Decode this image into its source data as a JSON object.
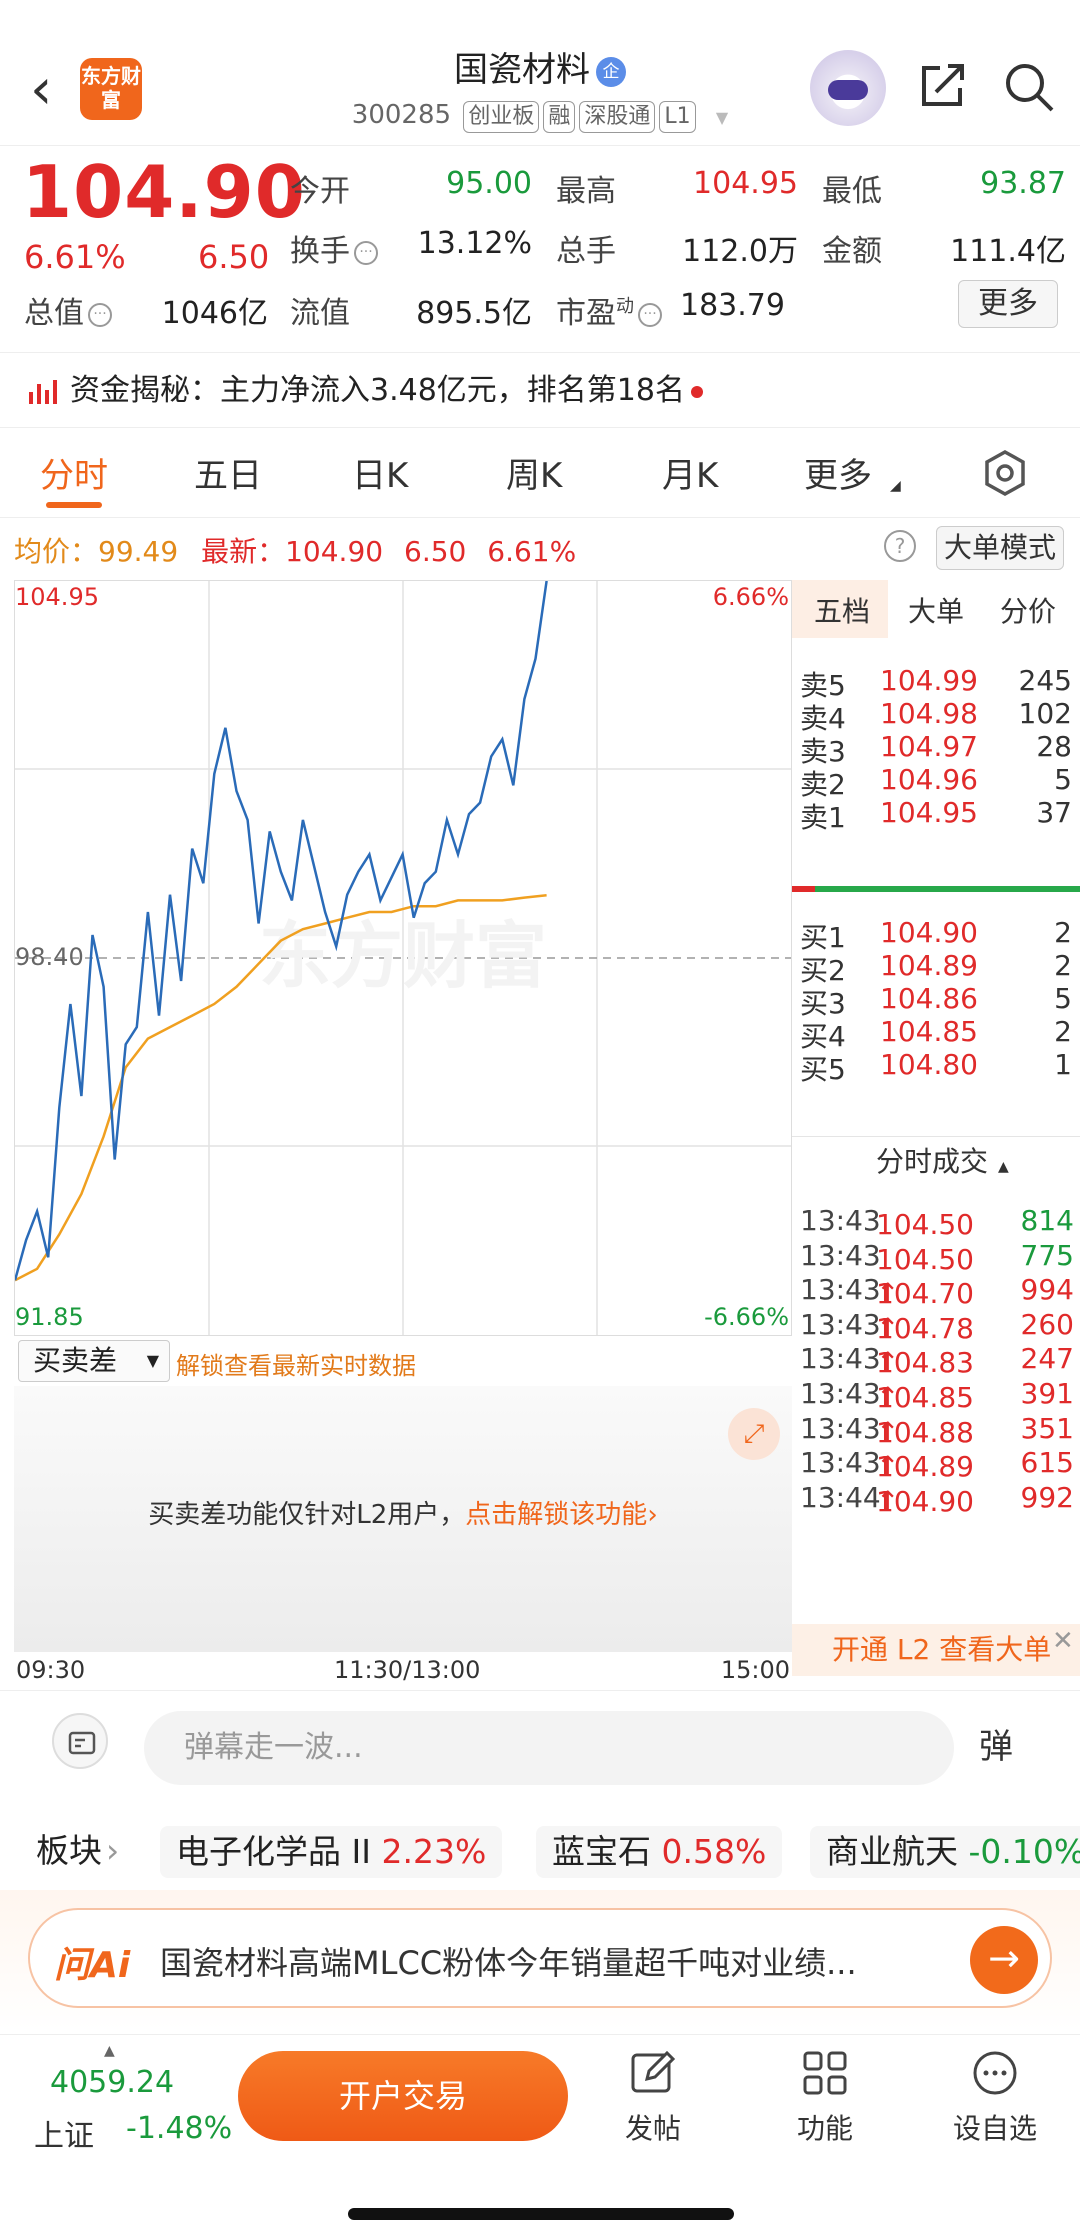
{
  "header": {
    "logo_text": "东方财富",
    "title": "国瓷材料",
    "title_badge": "企",
    "code": "300285",
    "tags": [
      "创业板",
      "融",
      "深股通",
      "L1"
    ]
  },
  "quote": {
    "price": "104.90",
    "change_pct": "6.61%",
    "change": "6.50",
    "fields": [
      {
        "label": "今开",
        "value": "95.00",
        "color": "green"
      },
      {
        "label": "最高",
        "value": "104.95",
        "color": "red"
      },
      {
        "label": "最低",
        "value": "93.87",
        "color": "green"
      },
      {
        "label": "换手",
        "value": "13.12%",
        "color": "black"
      },
      {
        "label": "总手",
        "value": "112.0万",
        "color": "black"
      },
      {
        "label": "金额",
        "value": "111.4亿",
        "color": "black"
      },
      {
        "label": "总值",
        "value": "1046亿",
        "color": "black"
      },
      {
        "label": "流值",
        "value": "895.5亿",
        "color": "black"
      },
      {
        "label": "市盈",
        "label_sup": "动",
        "value": "183.79",
        "color": "black"
      }
    ],
    "more_button": "更多"
  },
  "capital_flow": {
    "text": "资金揭秘：主力净流入3.48亿元，排名第18名"
  },
  "tabs": {
    "items": [
      "分时",
      "五日",
      "日K",
      "周K",
      "月K",
      "更多"
    ],
    "active": "分时"
  },
  "avg_row": {
    "avg_label": "均价：",
    "avg_value": "99.49",
    "latest_label": "最新：",
    "latest_value": "104.90",
    "latest_change": "6.50",
    "latest_pct": "6.61%",
    "help": "?",
    "big_mode": "大单模式"
  },
  "chart_data": {
    "type": "line",
    "y_top": "104.95",
    "y_mid": "98.40",
    "y_bottom": "91.85",
    "pct_top": "6.66%",
    "pct_bottom": "-6.66%",
    "ylim": [
      91.85,
      104.95
    ],
    "watermark": "东方财富",
    "series": [
      {
        "values": [
          92.8,
          93.5,
          94.0,
          93.2,
          95.8,
          97.6,
          96.0,
          98.8,
          97.9,
          94.9,
          96.9,
          97.2,
          99.2,
          97.4,
          99.5,
          98.0,
          100.3,
          99.7,
          101.6,
          102.4,
          101.3,
          100.8,
          99.0,
          100.6,
          99.9,
          99.4,
          100.8,
          100.0,
          99.2,
          98.6,
          99.5,
          99.9,
          100.2,
          99.4,
          99.8,
          100.2,
          99.1,
          99.7,
          99.9,
          100.8,
          100.2,
          100.9,
          101.1,
          101.9,
          102.2,
          101.4,
          102.9,
          103.6,
          104.95
        ]
      },
      {
        "values": [
          92.8,
          93.0,
          93.6,
          94.3,
          95.3,
          96.5,
          97.0,
          97.2,
          97.4,
          97.6,
          97.9,
          98.3,
          98.7,
          98.9,
          99.0,
          99.1,
          99.2,
          99.2,
          99.3,
          99.3,
          99.4,
          99.4,
          99.4,
          99.45,
          99.49
        ]
      }
    ]
  },
  "order_book": {
    "tabs": [
      "五档",
      "大单",
      "分价"
    ],
    "active_tab": "五档",
    "sells": [
      {
        "label": "卖5",
        "price": "104.99",
        "vol": "245"
      },
      {
        "label": "卖4",
        "price": "104.98",
        "vol": "102"
      },
      {
        "label": "卖3",
        "price": "104.97",
        "vol": "28"
      },
      {
        "label": "卖2",
        "price": "104.96",
        "vol": "5"
      },
      {
        "label": "卖1",
        "price": "104.95",
        "vol": "37"
      }
    ],
    "buys": [
      {
        "label": "买1",
        "price": "104.90",
        "vol": "2"
      },
      {
        "label": "买2",
        "price": "104.89",
        "vol": "2"
      },
      {
        "label": "买3",
        "price": "104.86",
        "vol": "5"
      },
      {
        "label": "买4",
        "price": "104.85",
        "vol": "2"
      },
      {
        "label": "买5",
        "price": "104.80",
        "vol": "1"
      }
    ],
    "trades_title": "分时成交",
    "trades": [
      {
        "time": "13:43",
        "price": "104.50",
        "arrow": "",
        "vol": "814",
        "color": "green"
      },
      {
        "time": "13:43",
        "price": "104.50",
        "arrow": "",
        "vol": "775",
        "color": "green"
      },
      {
        "time": "13:43",
        "price": "104.70",
        "arrow": "↑",
        "vol": "994",
        "color": "red"
      },
      {
        "time": "13:43",
        "price": "104.78",
        "arrow": "↑",
        "vol": "260",
        "color": "red"
      },
      {
        "time": "13:43",
        "price": "104.83",
        "arrow": "↑",
        "vol": "247",
        "color": "red"
      },
      {
        "time": "13:43",
        "price": "104.85",
        "arrow": "↑",
        "vol": "391",
        "color": "red"
      },
      {
        "time": "13:43",
        "price": "104.88",
        "arrow": "↑",
        "vol": "351",
        "color": "red"
      },
      {
        "time": "13:43",
        "price": "104.89",
        "arrow": "↑",
        "vol": "615",
        "color": "red"
      },
      {
        "time": "13:44",
        "price": "104.90",
        "arrow": "↑",
        "vol": "992",
        "color": "red"
      }
    ],
    "l2_promo": "开通 L2 查看大单"
  },
  "buy_sell_diff": {
    "select_label": "买卖差",
    "unlock_link": "解锁查看最新实时数据",
    "message": "买卖差功能仅针对L2用户，",
    "message_link": "点击解锁该功能"
  },
  "time_axis": [
    "09:30",
    "11:30/13:00",
    "15:00"
  ],
  "danmu": {
    "placeholder": "弹幕走一波...",
    "button": "弹"
  },
  "sectors": {
    "label": "板块",
    "items": [
      {
        "name": "电子化学品 II",
        "pct": "2.23%",
        "color": "red"
      },
      {
        "name": "蓝宝石",
        "pct": "0.58%",
        "color": "red"
      },
      {
        "name": "商业航天",
        "pct": "-0.10%",
        "color": "green"
      }
    ]
  },
  "ai": {
    "logo": "问Ai",
    "text": "国瓷材料高端MLCC粉体今年销量超千吨对业绩..."
  },
  "bottom_nav": {
    "index_value": "4059.24",
    "index_name": "上证",
    "index_change": "-1.48%",
    "trade_button": "开户交易",
    "items": [
      "发帖",
      "功能",
      "设自选"
    ]
  },
  "colors": {
    "up": "#e02a2a",
    "down": "#1a9a3c",
    "accent": "#f0661c",
    "price_line": "#2a6bb8",
    "avg_line": "#f0a020"
  }
}
